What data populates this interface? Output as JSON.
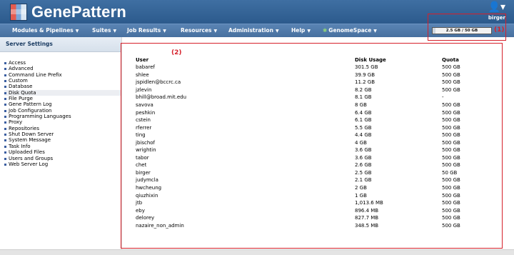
{
  "app": {
    "logo_text": "GenePattern",
    "logo_icon": "genepattern-logo-icon"
  },
  "user": {
    "name": "birger",
    "icon": "user-icon"
  },
  "nav": [
    {
      "label": "Modules & Pipelines",
      "caret": "▼"
    },
    {
      "label": "Suites",
      "caret": "▼"
    },
    {
      "label": "Job Results",
      "caret": "▼"
    },
    {
      "label": "Resources",
      "caret": "▼"
    },
    {
      "label": "Administration",
      "caret": "▼"
    },
    {
      "label": "Help",
      "caret": "▼"
    },
    {
      "label": "GenomeSpace",
      "caret": "▼",
      "icon": "✱"
    }
  ],
  "quota_meter": {
    "text": "2.5 GB / 50 GB",
    "used_fraction": 0.05
  },
  "sidebar": {
    "title": "Server Settings",
    "items": [
      "Access",
      "Advanced",
      "Command Line Prefix",
      "Custom",
      "Database",
      "Disk Quota",
      "File Purge",
      "Gene Pattern Log",
      "Job Configuration",
      "Programming Languages",
      "Proxy",
      "Repositories",
      "Shut Down Server",
      "System Message",
      "Task Info",
      "Uploaded Files",
      "Users and Groups",
      "Web Server Log"
    ],
    "active": "Disk Quota"
  },
  "table": {
    "headers": [
      "User",
      "Disk Usage",
      "Quota"
    ],
    "rows": [
      [
        "babaref",
        "301.5 GB",
        "500 GB"
      ],
      [
        "shlee",
        "39.9 GB",
        "500 GB"
      ],
      [
        "jspidlen@bccrc.ca",
        "11.2 GB",
        "500 GB"
      ],
      [
        "jzlevin",
        "8.2 GB",
        "500 GB"
      ],
      [
        "bhill@broad.mit.edu",
        "8.1 GB",
        "-"
      ],
      [
        "savova",
        "8 GB",
        "500 GB"
      ],
      [
        "peshkin",
        "6.4 GB",
        "500 GB"
      ],
      [
        "cstein",
        "6.1 GB",
        "500 GB"
      ],
      [
        "rferrer",
        "5.5 GB",
        "500 GB"
      ],
      [
        "ting",
        "4.4 GB",
        "500 GB"
      ],
      [
        "jbischof",
        "4 GB",
        "500 GB"
      ],
      [
        "wrightin",
        "3.6 GB",
        "500 GB"
      ],
      [
        "tabor",
        "3.6 GB",
        "500 GB"
      ],
      [
        "chet",
        "2.6 GB",
        "500 GB"
      ],
      [
        "birger",
        "2.5 GB",
        "50 GB"
      ],
      [
        "judymcla",
        "2.1 GB",
        "500 GB"
      ],
      [
        "hwcheung",
        "2 GB",
        "500 GB"
      ],
      [
        "qiuzhixin",
        "1 GB",
        "500 GB"
      ],
      [
        "jtb",
        "1,013.6 MB",
        "500 GB"
      ],
      [
        "eby",
        "896.4 MB",
        "500 GB"
      ],
      [
        "delorey",
        "827.7 MB",
        "500 GB"
      ],
      [
        "nazaire_non_admin",
        "348.5 MB",
        "500 GB"
      ]
    ]
  },
  "annotations": {
    "label_1": "(1)",
    "label_2": "(2)",
    "color": "#d6202a"
  },
  "colors": {
    "header": "#2c5a8c",
    "nav": "#47709f",
    "sidebar_title_text": "#1c3d63"
  }
}
